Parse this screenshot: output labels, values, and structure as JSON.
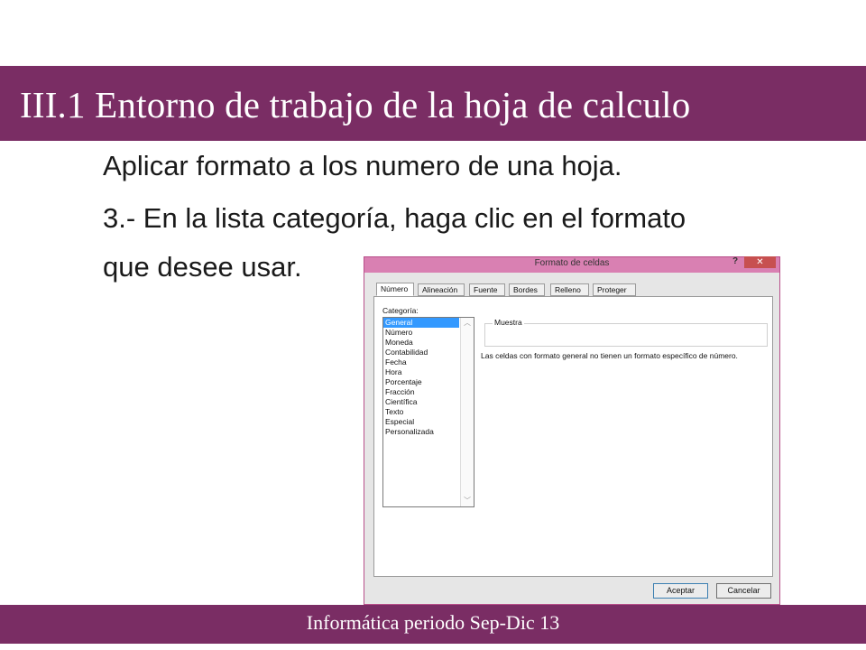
{
  "slide": {
    "title": "III.1  Entorno  de trabajo de la hoja de calculo",
    "line1": "Aplicar formato a los numero de una hoja.",
    "line2": "3.-  En la lista categoría, haga clic en el formato",
    "line3": "que desee usar.",
    "footer": "Informática periodo Sep-Dic 13",
    "accent_color": "#7a2d64"
  },
  "dialog": {
    "title": "Formato de celdas",
    "help": "?",
    "close": "✕",
    "tabs": [
      "Número",
      "Alineación",
      "Fuente",
      "Bordes",
      "Relleno",
      "Proteger"
    ],
    "category_label": "Categoría:",
    "categories": [
      "General",
      "Número",
      "Moneda",
      "Contabilidad",
      "Fecha",
      "Hora",
      "Porcentaje",
      "Fracción",
      "Científica",
      "Texto",
      "Especial",
      "Personalizada"
    ],
    "selected_category": "General",
    "sample_label": "Muestra",
    "description": "Las celdas con formato general no tienen un formato específico de número.",
    "ok_label": "Aceptar",
    "cancel_label": "Cancelar"
  }
}
